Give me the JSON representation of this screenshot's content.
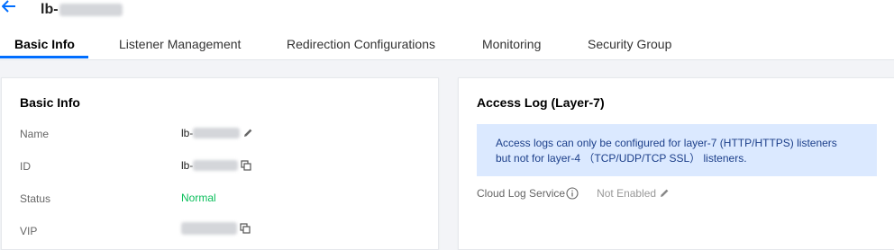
{
  "header": {
    "back_icon": "arrow-left-icon",
    "title_prefix": "lb-"
  },
  "tabs": [
    {
      "label": "Basic Info",
      "active": true
    },
    {
      "label": "Listener Management",
      "active": false
    },
    {
      "label": "Redirection Configurations",
      "active": false
    },
    {
      "label": "Monitoring",
      "active": false
    },
    {
      "label": "Security Group",
      "active": false
    }
  ],
  "basic_info": {
    "title": "Basic Info",
    "fields": {
      "name": {
        "label": "Name",
        "value_prefix": "lb-"
      },
      "id": {
        "label": "ID",
        "value_prefix": "lb-"
      },
      "status": {
        "label": "Status",
        "value": "Normal",
        "color": "#0abf5b"
      },
      "vip": {
        "label": "VIP"
      }
    }
  },
  "access_log": {
    "title": "Access Log (Layer-7)",
    "notice_line1": "Access logs can only be configured for layer-7 (HTTP/HTTPS) listeners",
    "notice_line2": "but not for layer-4 （TCP/UDP/TCP SSL） listeners.",
    "cls_label": "Cloud Log Service",
    "cls_value": "Not Enabled"
  },
  "colors": {
    "accent": "#006eff",
    "notice_bg": "#dbe9ff",
    "status_normal": "#0abf5b"
  }
}
